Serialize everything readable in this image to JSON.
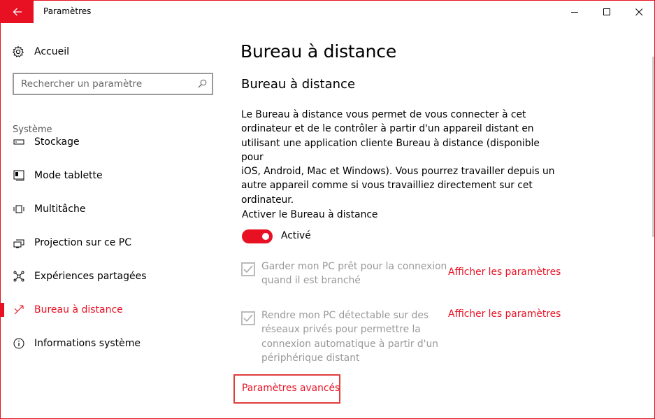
{
  "window": {
    "title": "Paramètres",
    "accent_color": "#e81123"
  },
  "sidebar": {
    "home_label": "Accueil",
    "search_placeholder": "Rechercher un paramètre",
    "section_title": "Système",
    "items": [
      {
        "label": "Stockage",
        "icon": "storage-icon",
        "active": false
      },
      {
        "label": "Mode tablette",
        "icon": "tablet-mode-icon",
        "active": false
      },
      {
        "label": "Multitâche",
        "icon": "multitasking-icon",
        "active": false
      },
      {
        "label": "Projection sur ce PC",
        "icon": "projection-icon",
        "active": false
      },
      {
        "label": "Expériences partagées",
        "icon": "shared-experiences-icon",
        "active": false
      },
      {
        "label": "Bureau à distance",
        "icon": "remote-desktop-icon",
        "active": true
      },
      {
        "label": "Informations système",
        "icon": "info-icon",
        "active": false
      }
    ]
  },
  "main": {
    "page_title": "Bureau à distance",
    "section_title": "Bureau à distance",
    "description_lines": [
      "Le Bureau à distance vous permet de vous connecter à cet",
      "ordinateur et de le contrôler à partir d'un appareil distant en",
      "utilisant une application cliente Bureau à distance (disponible pour",
      "iOS, Android, Mac et Windows). Vous pourrez travailler depuis un",
      "autre appareil comme si vous travailliez directement sur cet",
      "ordinateur."
    ],
    "toggle_label": "Activer le Bureau à distance",
    "toggle_state": "Activé",
    "options": [
      {
        "lines": [
          "Garder mon PC prêt pour la connexion",
          "quand il est branché"
        ],
        "checked": true,
        "link": "Afficher les paramètres"
      },
      {
        "lines": [
          "Rendre mon PC détectable sur des",
          "réseaux privés pour permettre la",
          "connexion automatique à partir d'un",
          "périphérique distant"
        ],
        "checked": true,
        "link": "Afficher les paramètres"
      }
    ],
    "advanced_link": "Paramètres avancés"
  }
}
